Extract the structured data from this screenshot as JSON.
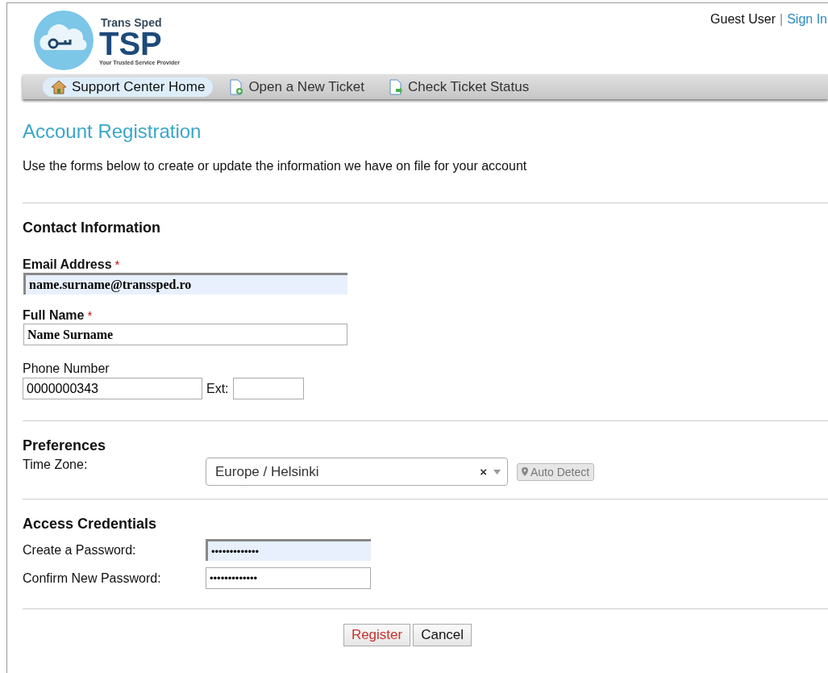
{
  "logo": {
    "brand_top": "Trans Sped",
    "brand_main": "TSP",
    "tagline": "Your Trusted Service Provider"
  },
  "user_bar": {
    "user": "Guest User",
    "separator": "|",
    "sign_in": "Sign In"
  },
  "nav": [
    {
      "label": "Support Center Home",
      "selected": true
    },
    {
      "label": "Open a New Ticket",
      "selected": false
    },
    {
      "label": "Check Ticket Status",
      "selected": false
    }
  ],
  "page": {
    "title": "Account Registration",
    "description": "Use the forms below to create or update the information we have on file for your account"
  },
  "contact": {
    "heading": "Contact Information",
    "required_mark": "*",
    "email": {
      "label": "Email Address",
      "required": true,
      "value": "name.surname@transsped.ro",
      "autofilled": true
    },
    "full_name": {
      "label": "Full Name",
      "required": true,
      "value": "Name Surname",
      "autofilled": false
    },
    "phone": {
      "label": "Phone Number",
      "value": "0000000343",
      "ext_label": "Ext:"
    }
  },
  "preferences": {
    "heading": "Preferences",
    "time_zone_label": "Time Zone:",
    "time_zone": "Europe / Helsinki",
    "clear": "×",
    "auto_detect": "Auto Detect"
  },
  "credentials": {
    "heading": "Access Credentials",
    "fields": [
      {
        "label": "Create a Password:",
        "value": "•••••••••••••",
        "autofilled": true
      },
      {
        "label": "Confirm New Password:",
        "value": "•••••••••••••",
        "autofilled": false
      }
    ]
  },
  "buttons": [
    {
      "label": "Register",
      "kind": "primary"
    },
    {
      "label": "Cancel",
      "kind": "secondary"
    }
  ]
}
